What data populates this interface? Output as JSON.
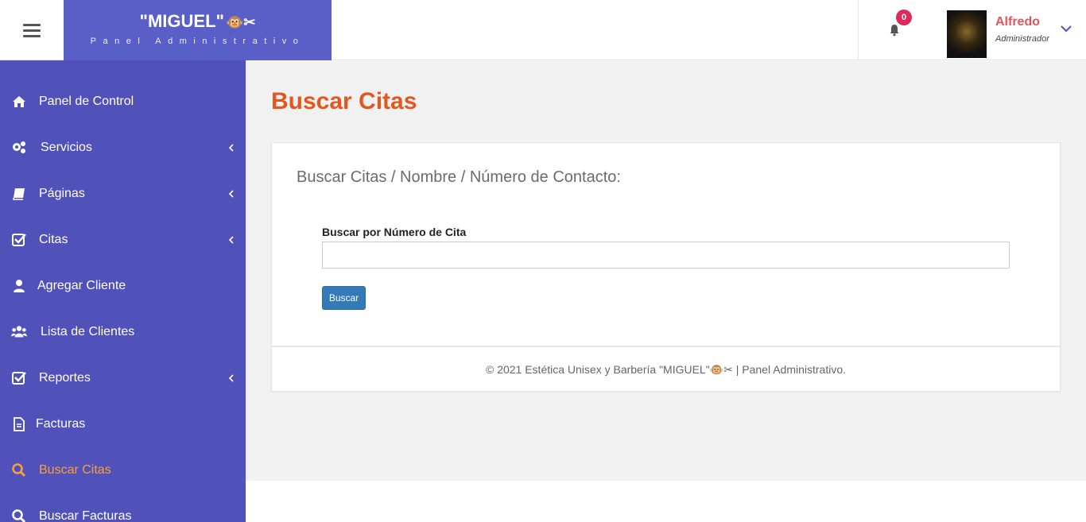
{
  "header": {
    "brand_name": "\"MIGUEL\"",
    "brand_emoji": "🐵✂",
    "brand_subtitle": "Panel Administrativo",
    "notification_count": "0",
    "user_name": "Alfredo",
    "user_role": "Administrador"
  },
  "sidebar": {
    "items": [
      {
        "label": "Panel de Control",
        "icon": "home-icon"
      },
      {
        "label": "Servicios",
        "icon": "gears-icon"
      },
      {
        "label": "Páginas",
        "icon": "book-icon"
      },
      {
        "label": "Citas",
        "icon": "check-square-icon"
      },
      {
        "label": "Agregar Cliente",
        "icon": "user-icon"
      },
      {
        "label": "Lista de Clientes",
        "icon": "users-icon"
      },
      {
        "label": "Reportes",
        "icon": "check-square-icon"
      },
      {
        "label": "Facturas",
        "icon": "file-icon"
      },
      {
        "label": "Buscar Citas",
        "icon": "search-icon"
      },
      {
        "label": "Buscar Facturas",
        "icon": "search-icon"
      }
    ]
  },
  "main": {
    "page_title": "Buscar Citas",
    "card_title": "Buscar Citas / Nombre / Número de Contacto:",
    "field_label": "Buscar por Número de Cita",
    "input_value": "",
    "button_label": "Buscar",
    "footer_prefix": "© 2021 Estética Unisex y Barbería \"MIGUEL\"",
    "footer_suffix": " | Panel Administrativo."
  },
  "colors": {
    "sidebar_bg": "#5152b9",
    "brand_bg": "#5a5fc7",
    "title_accent": "#e2561f",
    "active_item": "#f6a03c",
    "user_name": "#e2545b",
    "badge": "#e0285a",
    "button": "#337ab7"
  }
}
